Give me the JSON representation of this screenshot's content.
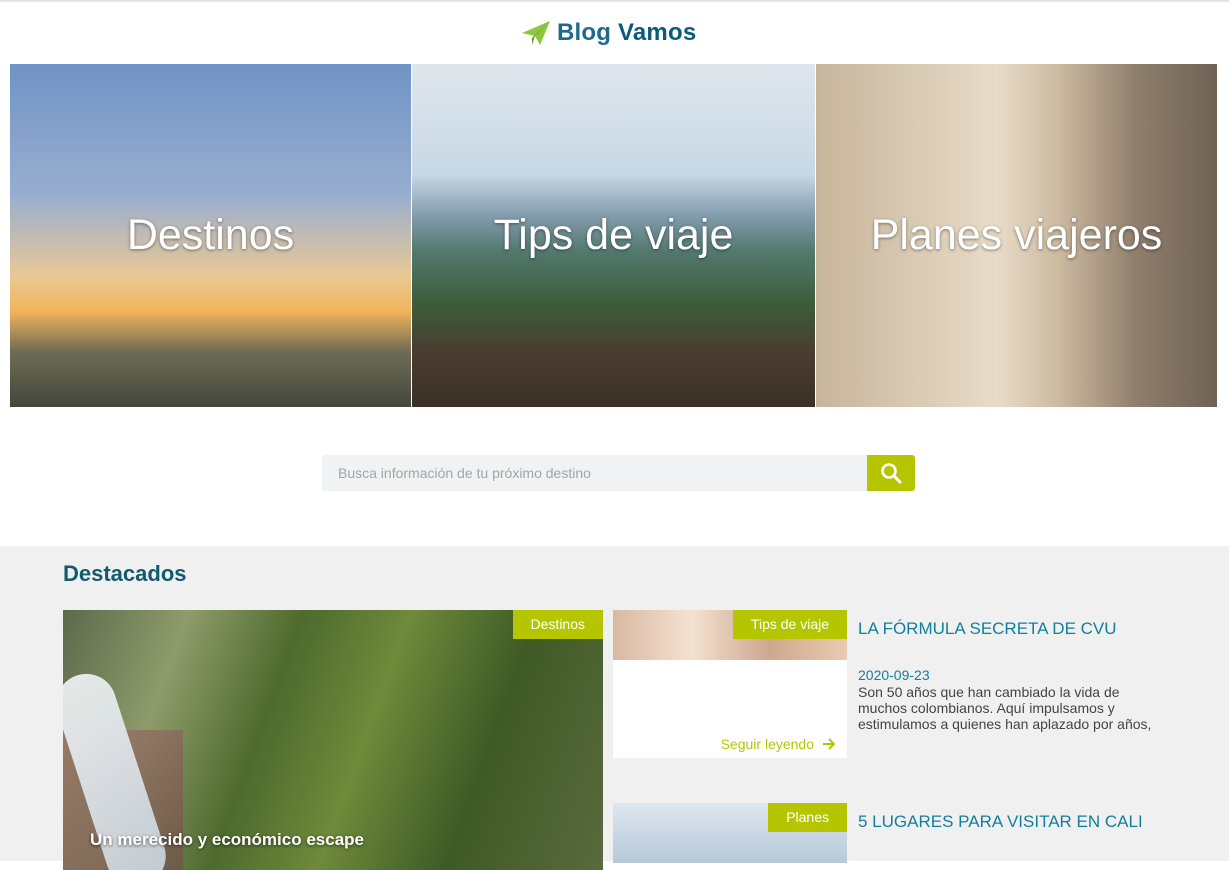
{
  "brand": {
    "name_part1": "Blog",
    "name_part2": "Vamos",
    "icon": "paper-plane-icon"
  },
  "hero_categories": [
    {
      "label": "Destinos"
    },
    {
      "label": "Tips de viaje"
    },
    {
      "label": "Planes viajeros"
    }
  ],
  "search": {
    "placeholder": "Busca información de tu próximo destino",
    "icon": "search-icon"
  },
  "featured": {
    "heading": "Destacados",
    "main_post": {
      "category": "Destinos",
      "title": "Un merecido y económico escape"
    },
    "posts": [
      {
        "category": "Tips de viaje",
        "title": "LA FÓRMULA SECRETA DE CVU",
        "date": "2020-09-23",
        "excerpt": "Son 50 años que han cambiado la vida de muchos colombianos. Aquí impulsamos y estimulamos a quienes han aplazado por años,",
        "read_more": "Seguir leyendo"
      },
      {
        "category": "Planes",
        "title": "5 LUGARES PARA VISITAR EN CALI"
      }
    ]
  },
  "colors": {
    "accent": "#b5c600",
    "brand": "#0b5a7a",
    "link": "#127f9b",
    "section_bg": "#f0f0f0"
  }
}
